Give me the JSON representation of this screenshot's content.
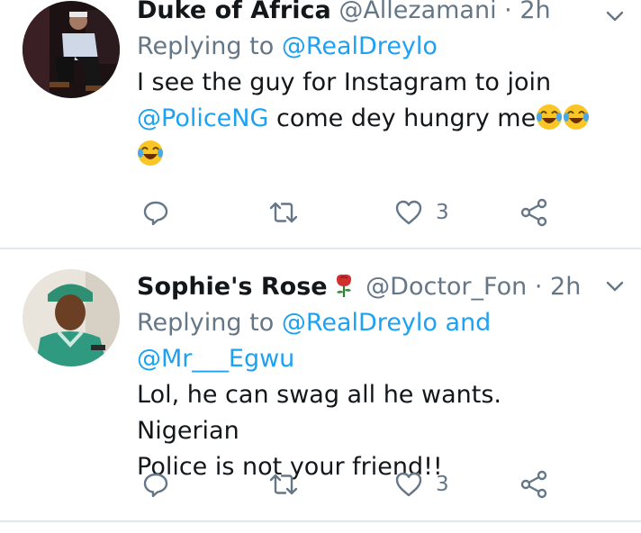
{
  "tweets": [
    {
      "display_name": "Duke of Africa",
      "handle": "@Allezamani",
      "separator": "·",
      "time": "2h",
      "replying_prefix": "Replying to ",
      "replying_to": [
        "@RealDreylo"
      ],
      "body_line1": "I see the guy for Instagram to join",
      "body_mention": "@PoliceNG",
      "body_rest": " come dey hungry me",
      "body_emojis": [
        "face-with-tears-of-joy",
        "face-with-tears-of-joy",
        "face-with-tears-of-joy"
      ],
      "like_count": "3",
      "avatar": "person-sitting-photo"
    },
    {
      "display_name": "Sophie's Rose",
      "name_emoji": "rose",
      "handle": "@Doctor_Fon",
      "separator": "·",
      "time": "2h",
      "replying_prefix": "Replying to ",
      "replying_to": [
        "@RealDreylo",
        "@Mr___Egwu"
      ],
      "replying_joiner": " and",
      "body_line1": "Lol, he can swag all he wants. Nigerian",
      "body_line2": "Police is not your friend!!",
      "like_count": "3",
      "avatar": "person-in-scrubs-photo"
    }
  ],
  "colors": {
    "link": "#1da1f2",
    "secondary_text": "#657786",
    "primary_text": "#14171a",
    "divider": "#e1e8ed"
  },
  "icons": [
    "reply-icon",
    "retweet-icon",
    "like-icon",
    "share-icon",
    "chevron-down-icon"
  ]
}
